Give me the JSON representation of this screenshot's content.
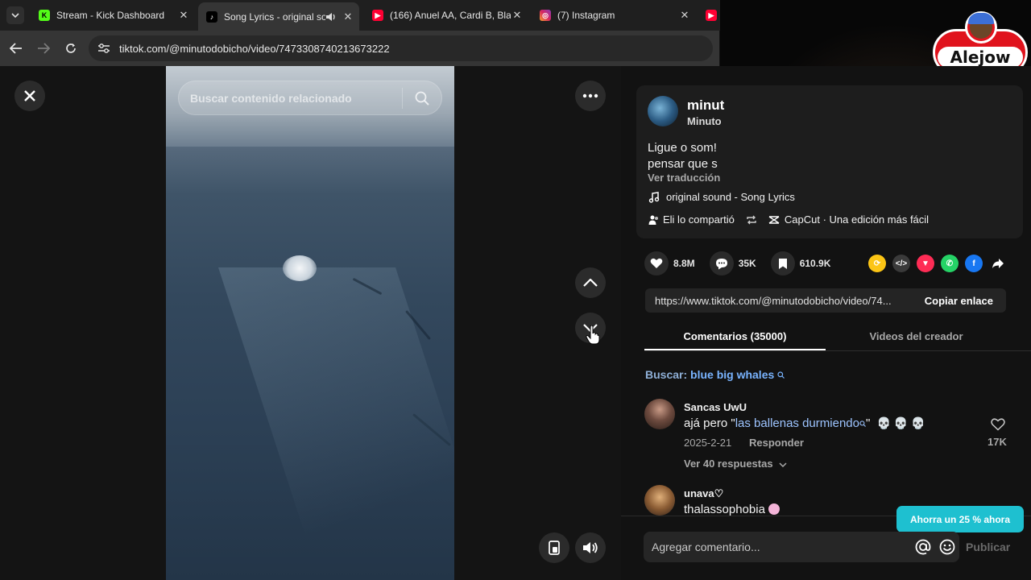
{
  "browser": {
    "tabs": [
      {
        "label": "Stream - Kick Dashboard",
        "favicon": "kick-icon"
      },
      {
        "label": "Song Lyrics - original sound",
        "favicon": "tiktok-icon",
        "active": true
      },
      {
        "label": "(166) Anuel AA, Cardi B, Black",
        "favicon": "youtube-icon"
      },
      {
        "label": "(7) Instagram",
        "favicon": "instagram-icon"
      }
    ],
    "url": "tiktok.com/@minutodobicho/video/7473308740213673222"
  },
  "overlay": {
    "streamer_logo": "Alejow"
  },
  "video": {
    "search_placeholder": "Buscar contenido relacionado"
  },
  "creator": {
    "name": "minut",
    "handle": "Minuto",
    "description_line1": "Ligue o som!",
    "description_line2": "pensar que s",
    "translate_label": "Ver traducción",
    "sound": "original sound - Song Lyrics",
    "shared_by": "Eli lo compartió",
    "capcut": "CapCut · Una edición más fácil"
  },
  "stats": {
    "likes": "8.8M",
    "comments": "35K",
    "saves": "610.9K"
  },
  "link": {
    "url": "https://www.tiktok.com/@minutodobicho/video/74...",
    "copy_label": "Copiar enlace"
  },
  "tabs": {
    "comments": "Comentarios (35000)",
    "creator_videos": "Videos del creador"
  },
  "search_suggestion": {
    "label": "Buscar:",
    "term": "blue big whales"
  },
  "comments": [
    {
      "user": "Sancas UwU",
      "text_prefix": "ajá pero \"",
      "text_link": "las ballenas durmiendo",
      "text_suffix": "\"",
      "emojis": "💀 💀 💀",
      "date": "2025-2-21",
      "reply": "Responder",
      "likes": "17K",
      "view_replies": "Ver 40 respuestas"
    },
    {
      "user": "unava♡",
      "text": "thalassophobia"
    }
  ],
  "promo": "Ahorra un 25 % ahora",
  "comment_box": {
    "placeholder": "Agregar comentario...",
    "publish": "Publicar"
  },
  "colors": {
    "accent_link": "#79b4ff",
    "promo": "#1ec0d0",
    "background": "#121212"
  }
}
